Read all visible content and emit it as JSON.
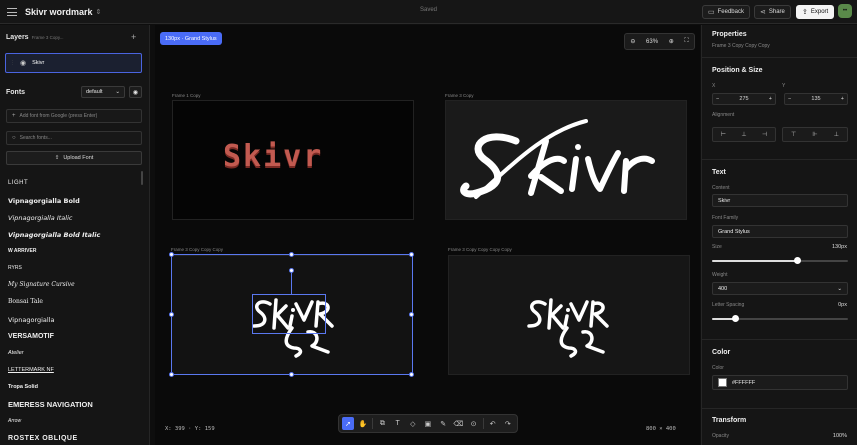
{
  "topbar": {
    "title": "Skivr wordmark",
    "status": "Saved",
    "feedback_label": "Feedback",
    "share_label": "Share",
    "export_label": "Export"
  },
  "layers": {
    "title": "Layers",
    "subtitle": "Frame 3 Copy...",
    "items": [
      {
        "label": "Skivr"
      }
    ]
  },
  "fonts": {
    "title": "Fonts",
    "filter_value": "default",
    "add_placeholder": "Add font from Google (press Enter)",
    "search_placeholder": "Search fonts...",
    "upload_label": "Upload Font",
    "items": [
      "LIGHT",
      "Vipnagorgialla Bold",
      "Vipnagorgialla Italic",
      "Vipnagorgialla Bold Italic",
      "W ARRIVER",
      "RYRS",
      "My Signature Cursive",
      "Bonsai Tale",
      "Vipnagorgialla",
      "VERSAMOTIF",
      "Atelier",
      "LETTERMARK NF",
      "Tropa Solid",
      "EMERESS NAVIGATION",
      "Arrow",
      "ROSTEX OBLIQUE"
    ]
  },
  "canvas": {
    "font_badge": "130px · Grand Stylus",
    "zoom": "63%",
    "frames": [
      {
        "label": "Frame 1 Copy",
        "text": "Skivr"
      },
      {
        "label": "Frame 3 Copy",
        "text": "Skivr"
      },
      {
        "label": "Frame 3 Copy Copy Copy",
        "text": "Skivr"
      },
      {
        "label": "Frame 3 Copy Copy Copy Copy",
        "text": "Skivr"
      }
    ],
    "coords": "X: 399 · Y: 159",
    "dims": "800 × 400"
  },
  "properties": {
    "title": "Properties",
    "subtitle": "Frame 3 Copy Copy Copy",
    "position_size": {
      "title": "Position & Size",
      "x_label": "X",
      "x_value": "275",
      "y_label": "Y",
      "y_value": "135",
      "alignment_label": "Alignment"
    },
    "text": {
      "title": "Text",
      "content_label": "Content",
      "content_value": "Skivr",
      "font_family_label": "Font Family",
      "font_family_value": "Grand Stylus",
      "size_label": "Size",
      "size_value": "130px",
      "size_fraction": 0.63,
      "weight_label": "Weight",
      "weight_value": "400",
      "letter_spacing_label": "Letter Spacing",
      "letter_spacing_value": "0px",
      "letter_spacing_fraction": 0.17
    },
    "color": {
      "title": "Color",
      "color_label": "Color",
      "color_value": "#FFFFFF"
    },
    "transform": {
      "title": "Transform",
      "opacity_label": "Opacity",
      "opacity_value": "100%"
    }
  }
}
